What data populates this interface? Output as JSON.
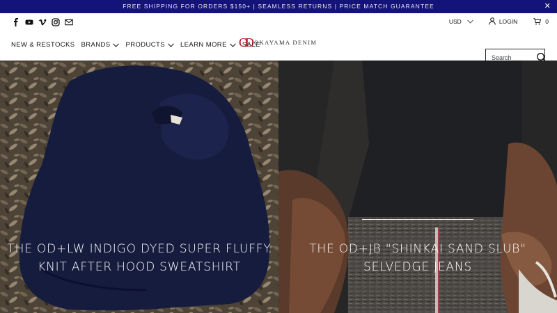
{
  "announcement": {
    "text": "FREE SHIPPING FOR ORDERS $150+ | SEAMLESS RETURNS | PRICE MATCH GUARANTEE",
    "close_symbol": "✕"
  },
  "social_icons": [
    "facebook-icon",
    "youtube-icon",
    "vimeo-icon",
    "instagram-icon",
    "email-icon"
  ],
  "nav": {
    "items": [
      {
        "label": "NEW & RESTOCKS",
        "dropdown": false
      },
      {
        "label": "BRANDS",
        "dropdown": true
      },
      {
        "label": "PRODUCTS",
        "dropdown": true
      },
      {
        "label": "LEARN MORE",
        "dropdown": true
      },
      {
        "label": "SALE",
        "dropdown": false
      }
    ]
  },
  "logo": {
    "mark": "OD",
    "text": "OKAYAMA DENIM"
  },
  "utility": {
    "currency": "USD",
    "login": "LOGIN",
    "cart_count": "0"
  },
  "search": {
    "placeholder": "Search"
  },
  "hero": {
    "left_caption": "THE OD+LW INDIGO DYED SUPER FLUFFY KNIT AFTER HOOD SWEATSHIRT",
    "right_caption": "THE OD+JB \"SHINKAI SAND SLUB\" SELVEDGE JEANS"
  },
  "colors": {
    "announcement_bg": "#13137a",
    "logo_red": "#b0141a"
  }
}
